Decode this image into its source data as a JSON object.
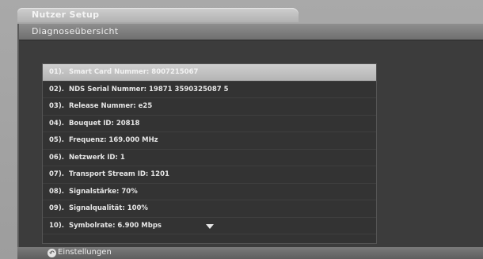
{
  "window": {
    "title": "Nutzer Setup",
    "section_title": "Diagnoseübersicht"
  },
  "diagnostics": {
    "items": [
      {
        "num": "01).",
        "text": "Smart Card Nummer: 8007215067",
        "selected": true
      },
      {
        "num": "02).",
        "text": "NDS Serial Nummer: 19871 3590325087 5",
        "selected": false
      },
      {
        "num": "03).",
        "text": "Release Nummer: e25",
        "selected": false
      },
      {
        "num": "04).",
        "text": "Bouquet ID: 20818",
        "selected": false
      },
      {
        "num": "05).",
        "text": "Frequenz: 169.000 MHz",
        "selected": false
      },
      {
        "num": "06).",
        "text": "Netzwerk ID: 1",
        "selected": false
      },
      {
        "num": "07).",
        "text": "Transport Stream ID: 1201",
        "selected": false
      },
      {
        "num": "08).",
        "text": "Signalstärke: 70%",
        "selected": false
      },
      {
        "num": "09).",
        "text": "Signalqualität: 100%",
        "selected": false
      },
      {
        "num": "10).",
        "text": "Symbolrate: 6.900 Mbps",
        "selected": false
      }
    ]
  },
  "footer": {
    "back_icon": "back-arrow-icon",
    "back_label": "Einstellungen"
  },
  "colors": {
    "panel_bg": "#3c3c3c",
    "highlight": "#c4c4c4",
    "text": "#e6e6e6"
  }
}
